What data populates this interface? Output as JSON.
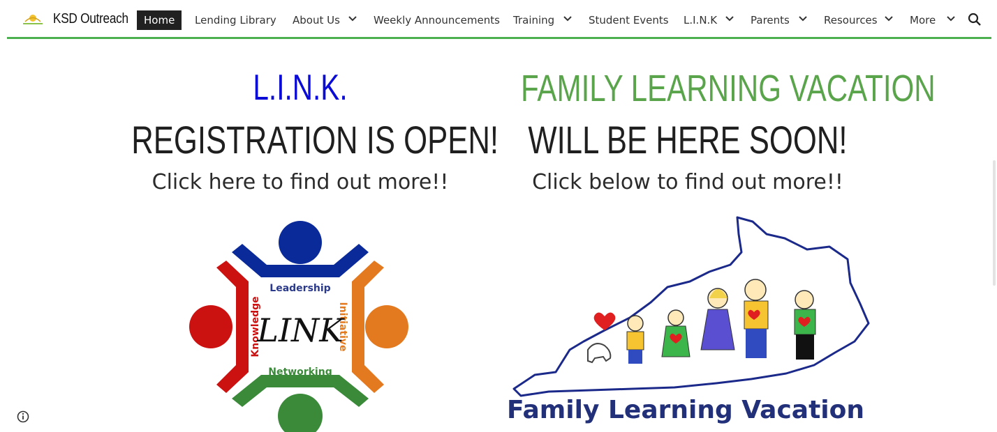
{
  "site": {
    "title": "KSD Outreach"
  },
  "nav": {
    "items": [
      {
        "label": "Home",
        "active": true
      },
      {
        "label": "Lending Library"
      },
      {
        "label": "About Us"
      },
      {
        "label": "Weekly Announcements"
      },
      {
        "label": "Training"
      },
      {
        "label": "Student Events"
      },
      {
        "label": "L.I.N.K"
      },
      {
        "label": "Parents"
      },
      {
        "label": "Resources"
      },
      {
        "label": "More"
      }
    ],
    "accent": "#4caf50"
  },
  "left": {
    "title": "L.I.N.K.",
    "subtitle": "REGISTRATION IS OPEN!",
    "cta": "Click here to find out more!!",
    "graphic": {
      "center": "LINK",
      "top": "Leadership",
      "left": "Knowledge",
      "right": "Initiative",
      "bottom": "Networking"
    },
    "title_color": "#0b0bd6"
  },
  "right": {
    "title": "FAMILY LEARNING VACATION",
    "subtitle": "WILL BE HERE SOON!",
    "cta": "Click below to find out more!!",
    "graphic_caption": "Family Learning Vacation",
    "title_color": "#5aa54b"
  },
  "icons": {
    "search": "search-icon",
    "info": "info-icon",
    "chevron": "chevron-down-icon"
  }
}
